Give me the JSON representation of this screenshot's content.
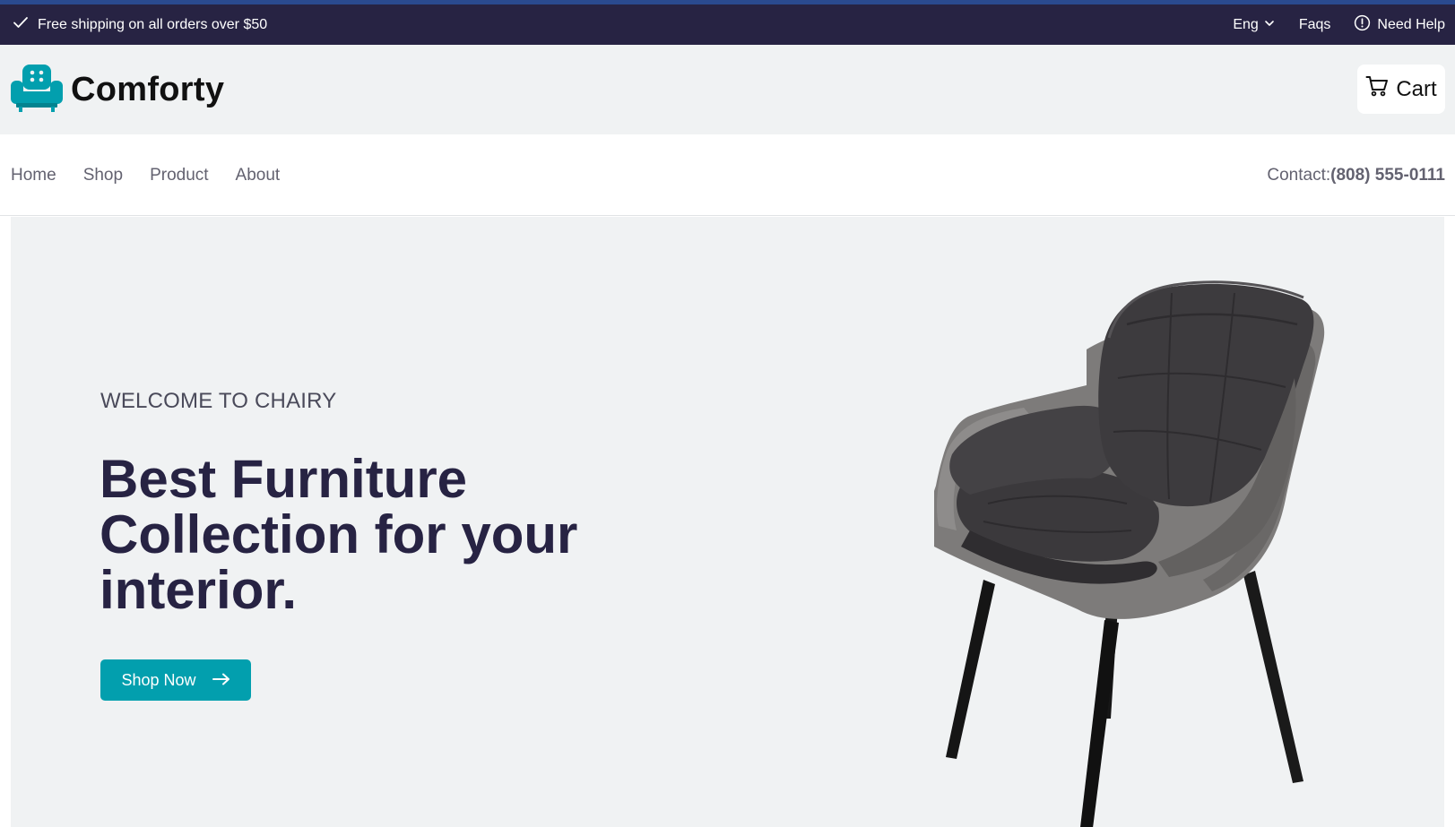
{
  "topbar": {
    "shipping_text": "Free shipping on all orders over $50",
    "language": "Eng",
    "faqs": "Faqs",
    "help": "Need Help"
  },
  "header": {
    "logo_text": "Comforty",
    "cart_label": "Cart"
  },
  "nav": {
    "items": [
      {
        "label": "Home"
      },
      {
        "label": "Shop"
      },
      {
        "label": "Product"
      },
      {
        "label": "About"
      }
    ],
    "contact_label": "Contact:",
    "contact_phone": "(808) 555-0111"
  },
  "hero": {
    "subtitle": "WELCOME TO CHAIRY",
    "title": "Best Furniture Collection for your interior.",
    "button_label": "Shop Now"
  },
  "colors": {
    "topbar_bg": "#272343",
    "accent": "#029fae",
    "header_bg": "#f0f2f3",
    "title_text": "#272343"
  },
  "icons": [
    "check-icon",
    "chevron-down-icon",
    "info-icon",
    "sofa-logo-icon",
    "cart-icon",
    "arrow-right-icon"
  ]
}
